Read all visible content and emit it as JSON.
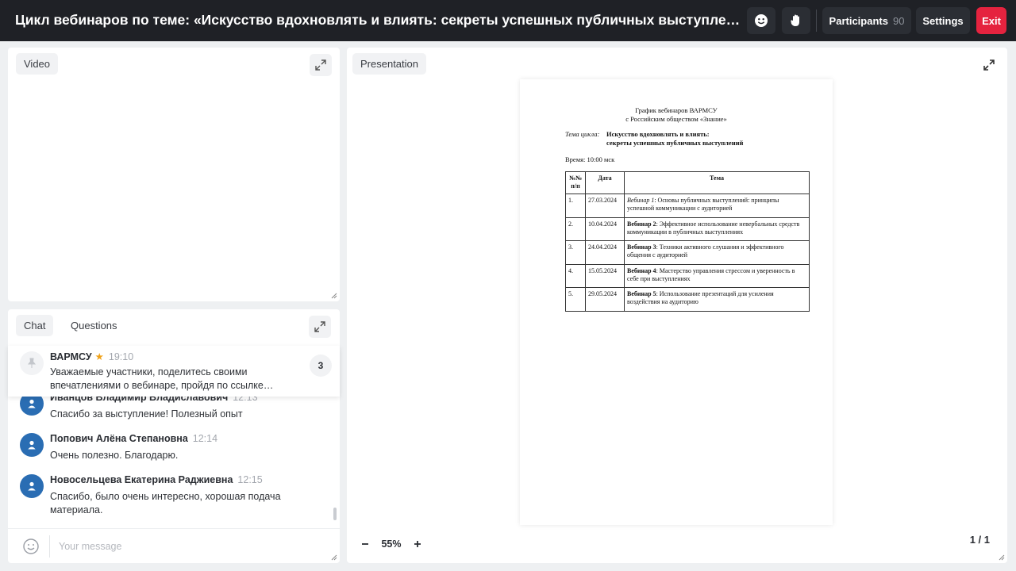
{
  "header": {
    "title": "Цикл вебинаров по теме: «Искусство вдохновлять и влиять: секреты успешных публичных выступлений»",
    "participants_label": "Participants",
    "participants_count": "90",
    "settings_label": "Settings",
    "exit_label": "Exit",
    "icons": [
      "smile-icon",
      "raise-hand-icon"
    ]
  },
  "video": {
    "tab_label": "Video"
  },
  "chat": {
    "tabs": [
      "Chat",
      "Questions"
    ],
    "pinned": {
      "author": "ВАРМСУ",
      "time": "19:10",
      "text": "Уважаемые участники, поделитесь своими впечатлениями о вебинаре, пройдя по ссылке…",
      "count": "3"
    },
    "messages": [
      {
        "author": "Иванцов Владимир Владиславович",
        "time": "12:13",
        "text": "Спасибо за выступление! Полезный опыт"
      },
      {
        "author": "Попович Алёна Степановна",
        "time": "12:14",
        "text": "Очень полезно. Благодарю."
      },
      {
        "author": "Новосельцева Екатерина Раджиевна",
        "time": "12:15",
        "text": "Спасибо, было очень интересно, хорошая подача материала."
      }
    ],
    "input_placeholder": "Your message"
  },
  "presentation": {
    "tab_label": "Presentation",
    "zoom": "55%",
    "page_indicator": "1 / 1",
    "document": {
      "heading_line1": "График вебинаров ВАРМСУ",
      "heading_line2": "с Российским обществом «Знание»",
      "theme_label": "Тема цикла:",
      "theme_value_line1": "Искусство вдохновлять и влиять:",
      "theme_value_line2": "секреты успешных публичных выступлений",
      "time": "Время: 10:00 мск",
      "table_headers": [
        "№№ п/п",
        "Дата",
        "Тема"
      ],
      "rows": [
        {
          "n": "1.",
          "date": "27.03.2024",
          "label": "Вебинар 1",
          "topic": ": Основы публичных выступлений: принципы успешной коммуникации с аудиторией"
        },
        {
          "n": "2.",
          "date": "10.04.2024",
          "label": "Вебинар 2",
          "topic": ": Эффективное использование невербальных средств коммуникации в публичных выступлениях"
        },
        {
          "n": "3.",
          "date": "24.04.2024",
          "label": "Вебинар 3",
          "topic": ": Техники активного слушания и эффективного общения с аудиторией"
        },
        {
          "n": "4.",
          "date": "15.05.2024",
          "label": "Вебинар 4",
          "topic": ": Мастерство управления стрессом и уверенность в себе при выступлениях"
        },
        {
          "n": "5.",
          "date": "29.05.2024",
          "label": "Вебинар 5",
          "topic": ": Использование презентаций для усиления воздействия на аудиторию"
        }
      ]
    }
  },
  "colors": {
    "header_bg": "#1f2126",
    "exit": "#e5233f",
    "avatar": "#2a6db3",
    "star": "#f0a21a"
  }
}
